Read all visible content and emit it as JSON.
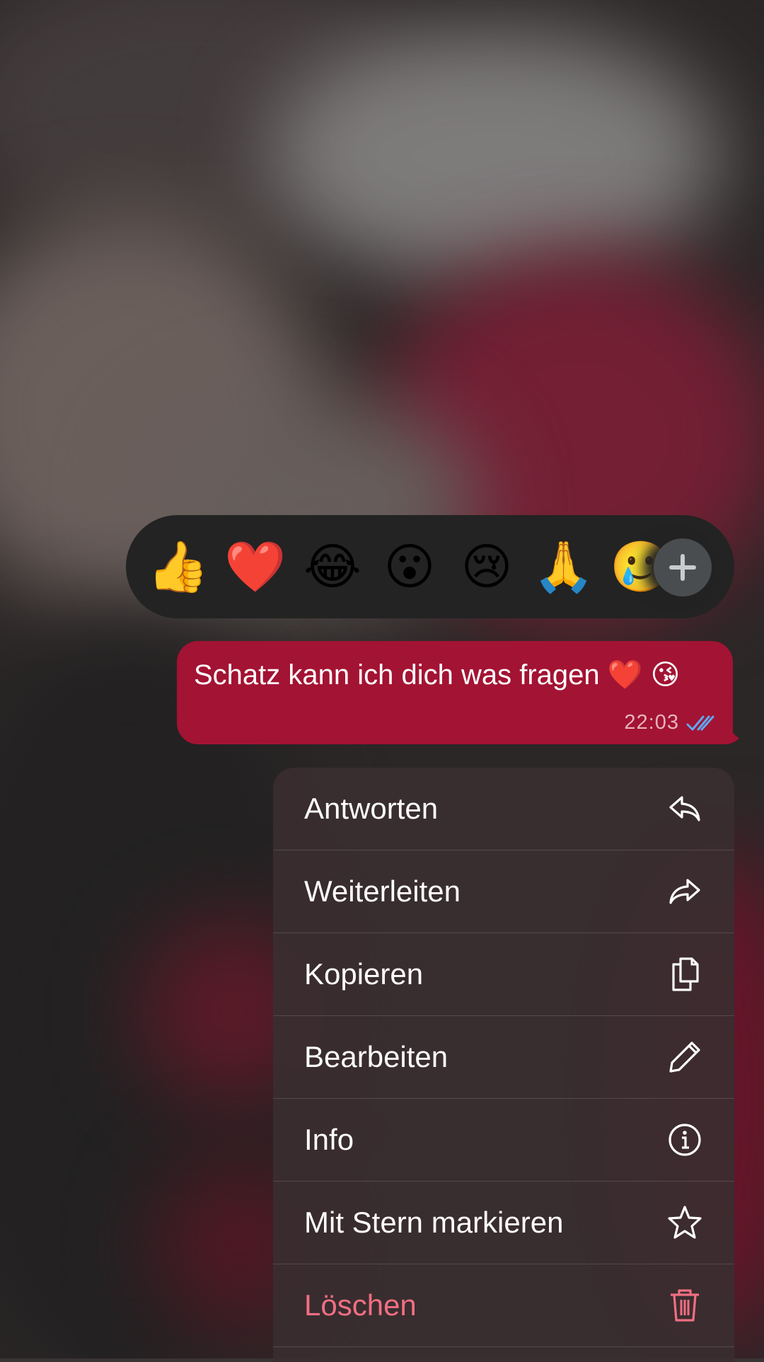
{
  "reactions": {
    "emojis": [
      "👍",
      "❤️",
      "😂",
      "😮",
      "😢",
      "🙏",
      "🥲"
    ]
  },
  "message": {
    "text": "Schatz kann ich dich was fragen ❤️ 😘",
    "time": "22:03",
    "status_icon": "double-check-read-icon"
  },
  "context_menu": {
    "items": [
      {
        "label": "Antworten",
        "icon": "reply-icon"
      },
      {
        "label": "Weiterleiten",
        "icon": "forward-icon"
      },
      {
        "label": "Kopieren",
        "icon": "copy-icon"
      },
      {
        "label": "Bearbeiten",
        "icon": "pencil-icon"
      },
      {
        "label": "Info",
        "icon": "info-icon"
      },
      {
        "label": "Mit Stern markieren",
        "icon": "star-icon"
      },
      {
        "label": "Löschen",
        "icon": "trash-icon",
        "color": "#f06f82"
      }
    ]
  },
  "colors": {
    "bubble": "#a31333",
    "reaction_bar": "#232323",
    "menu_bg": "#3a2e30",
    "danger": "#f06f82",
    "read_ticks": "#5ea9f2"
  }
}
